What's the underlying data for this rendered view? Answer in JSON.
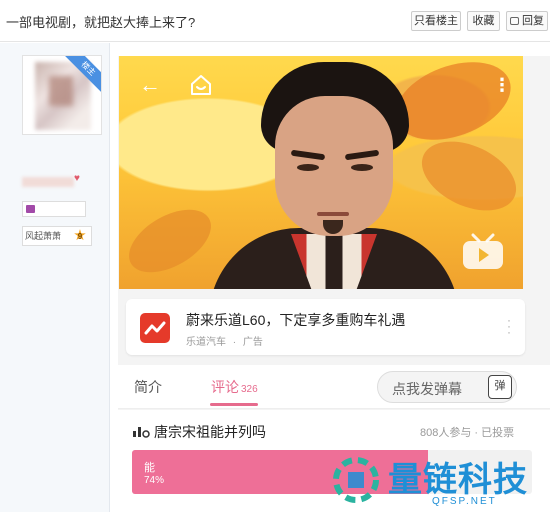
{
  "header": {
    "title": "一部电视剧，就把赵大捧上来了?",
    "buttons": {
      "only_op": "只看楼主",
      "favorite": "收藏",
      "reply": "回复"
    }
  },
  "author": {
    "floor_tag": "楼主",
    "level_name": "风起萧萧",
    "level_number": "9"
  },
  "video": {},
  "ad": {
    "title": "蔚来乐道L60，下定享多重购车礼遇",
    "advertiser": "乐道汽车",
    "separator": "·",
    "ad_label": "广告"
  },
  "tabs": {
    "intro": "简介",
    "comments": "评论",
    "comments_count": "326",
    "danmaku_placeholder": "点我发弹幕",
    "danmaku_icon_text": "弹"
  },
  "poll": {
    "title": "唐宗宋祖能并列吗",
    "meta": "808人参与 · 已投票",
    "option_label": "能",
    "option_percent": "74%",
    "option_fraction": 0.74
  },
  "watermark": {
    "text": "量链科技",
    "sub": "QFSP.NET"
  },
  "colors": {
    "accent_pink": "#e66b8d",
    "poll_fill": "#ee6f97",
    "ad_logo": "#e53a2a",
    "floor_ribbon": "#4a90e2",
    "watermark_blue": "#1f8fd6"
  }
}
